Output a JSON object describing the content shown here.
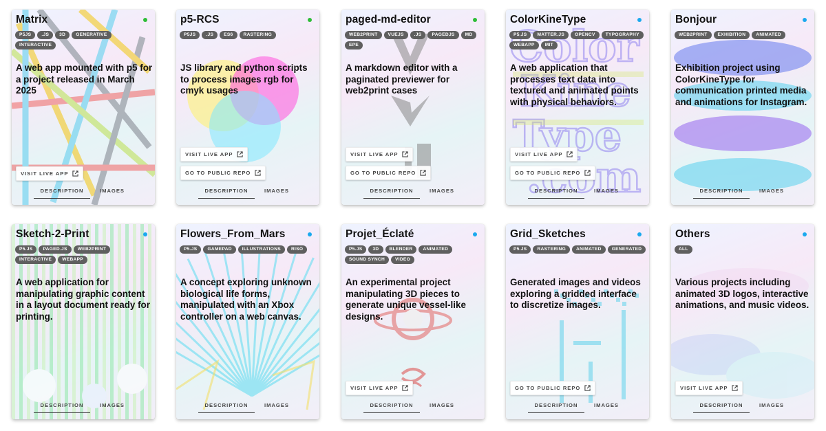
{
  "cards": [
    {
      "title": "Matrix",
      "status_color": "#2ebd37",
      "tags": [
        "P5JS",
        ".JS",
        "3D",
        "GENERATIVE",
        "INTERACTIVE"
      ],
      "description": "A web app mounted with p5 for a project released in March 2025",
      "buttons": [
        "VISIT LIVE APP"
      ],
      "tabs": {
        "description": "DESCRIPTION",
        "images": "IMAGES"
      }
    },
    {
      "title": "p5-RCS",
      "status_color": "#2ebd37",
      "tags": [
        "P5JS",
        ".JS",
        "ES6",
        "RASTERING"
      ],
      "description": "JS library and python scripts to process images rgb for cmyk usages",
      "buttons": [
        "VISIT LIVE APP",
        "GO TO PUBLIC REPO"
      ],
      "tabs": {
        "description": "DESCRIPTION",
        "images": "IMAGES"
      }
    },
    {
      "title": "paged-md-editor",
      "status_color": "#2ebd37",
      "tags": [
        "WEB2PRINT",
        "VUEJS",
        ".JS",
        "PAGEDJS",
        "MD",
        "EPE"
      ],
      "description": "A markdown editor with a paginated previewer for web2print cases",
      "buttons": [
        "VISIT LIVE APP",
        "GO TO PUBLIC REPO"
      ],
      "tabs": {
        "description": "DESCRIPTION",
        "images": "IMAGES"
      }
    },
    {
      "title": "ColorKineType",
      "status_color": "#1aa9ee",
      "tags": [
        "P5.JS",
        "MATTER.JS",
        "OPENCV",
        "TYPOGRAPHY",
        "WEBAPP",
        "MIT"
      ],
      "description": "A web application that processes text data into textured and animated points with physical behaviors.",
      "buttons": [
        "VISIT LIVE APP",
        "GO TO PUBLIC REPO"
      ],
      "tabs": {
        "description": "DESCRIPTION",
        "images": "IMAGES"
      }
    },
    {
      "title": "Bonjour",
      "status_color": "#1aa9ee",
      "tags": [
        "WEB2PRINT",
        "EXHIBITION",
        "ANIMATED"
      ],
      "description": "Exhibition project using ColorKineType for communication printed media and animations for Instagram.",
      "buttons": [],
      "tabs": {
        "description": "DESCRIPTION",
        "images": "IMAGES"
      }
    },
    {
      "title": "Sketch-2-Print",
      "status_color": "#1aa9ee",
      "tags": [
        "P5.JS",
        "PAGED.JS",
        "WEB2PRINT",
        "INTERACTIVE",
        "WEBAPP"
      ],
      "description": "A web application for manipulating graphic content in a layout document ready for printing.",
      "buttons": [],
      "tabs": {
        "description": "DESCRIPTION",
        "images": "IMAGES"
      }
    },
    {
      "title": "Flowers_From_Mars",
      "status_color": "#1aa9ee",
      "tags": [
        "P5.JS",
        "GAMEPAD",
        "ILLUSTRATIONS",
        "RISO"
      ],
      "description": "A concept exploring unknown biological life forms, manipulated with an Xbox controller on a web canvas.",
      "buttons": [],
      "tabs": {
        "description": "DESCRIPTION",
        "images": "IMAGES"
      }
    },
    {
      "title": "Projet_Éclaté",
      "status_color": "#1aa9ee",
      "tags": [
        "P5.JS",
        "3D",
        "BLENDER",
        "ANIMATED",
        "SOUND SYNCH",
        "VIDEO"
      ],
      "description": "An experimental project manipulating 3D pieces to generate unique vessel-like designs.",
      "buttons": [
        "VISIT LIVE APP"
      ],
      "tabs": {
        "description": "DESCRIPTION",
        "images": "IMAGES"
      }
    },
    {
      "title": "Grid_Sketches",
      "status_color": "#1aa9ee",
      "tags": [
        "P5.JS",
        "RASTERING",
        "ANIMATED",
        "GENERATED"
      ],
      "description": "Generated images and videos exploring a gridded interface to discretize images.",
      "buttons": [
        "GO TO PUBLIC REPO"
      ],
      "tabs": {
        "description": "DESCRIPTION",
        "images": "IMAGES"
      }
    },
    {
      "title": "Others",
      "status_color": "#1aa9ee",
      "tags": [
        "ALL"
      ],
      "description": "Various projects including animated 3D logos, interactive animations, and music videos.",
      "buttons": [
        "VISIT LIVE APP"
      ],
      "tabs": {
        "description": "DESCRIPTION",
        "images": "IMAGES"
      }
    }
  ]
}
